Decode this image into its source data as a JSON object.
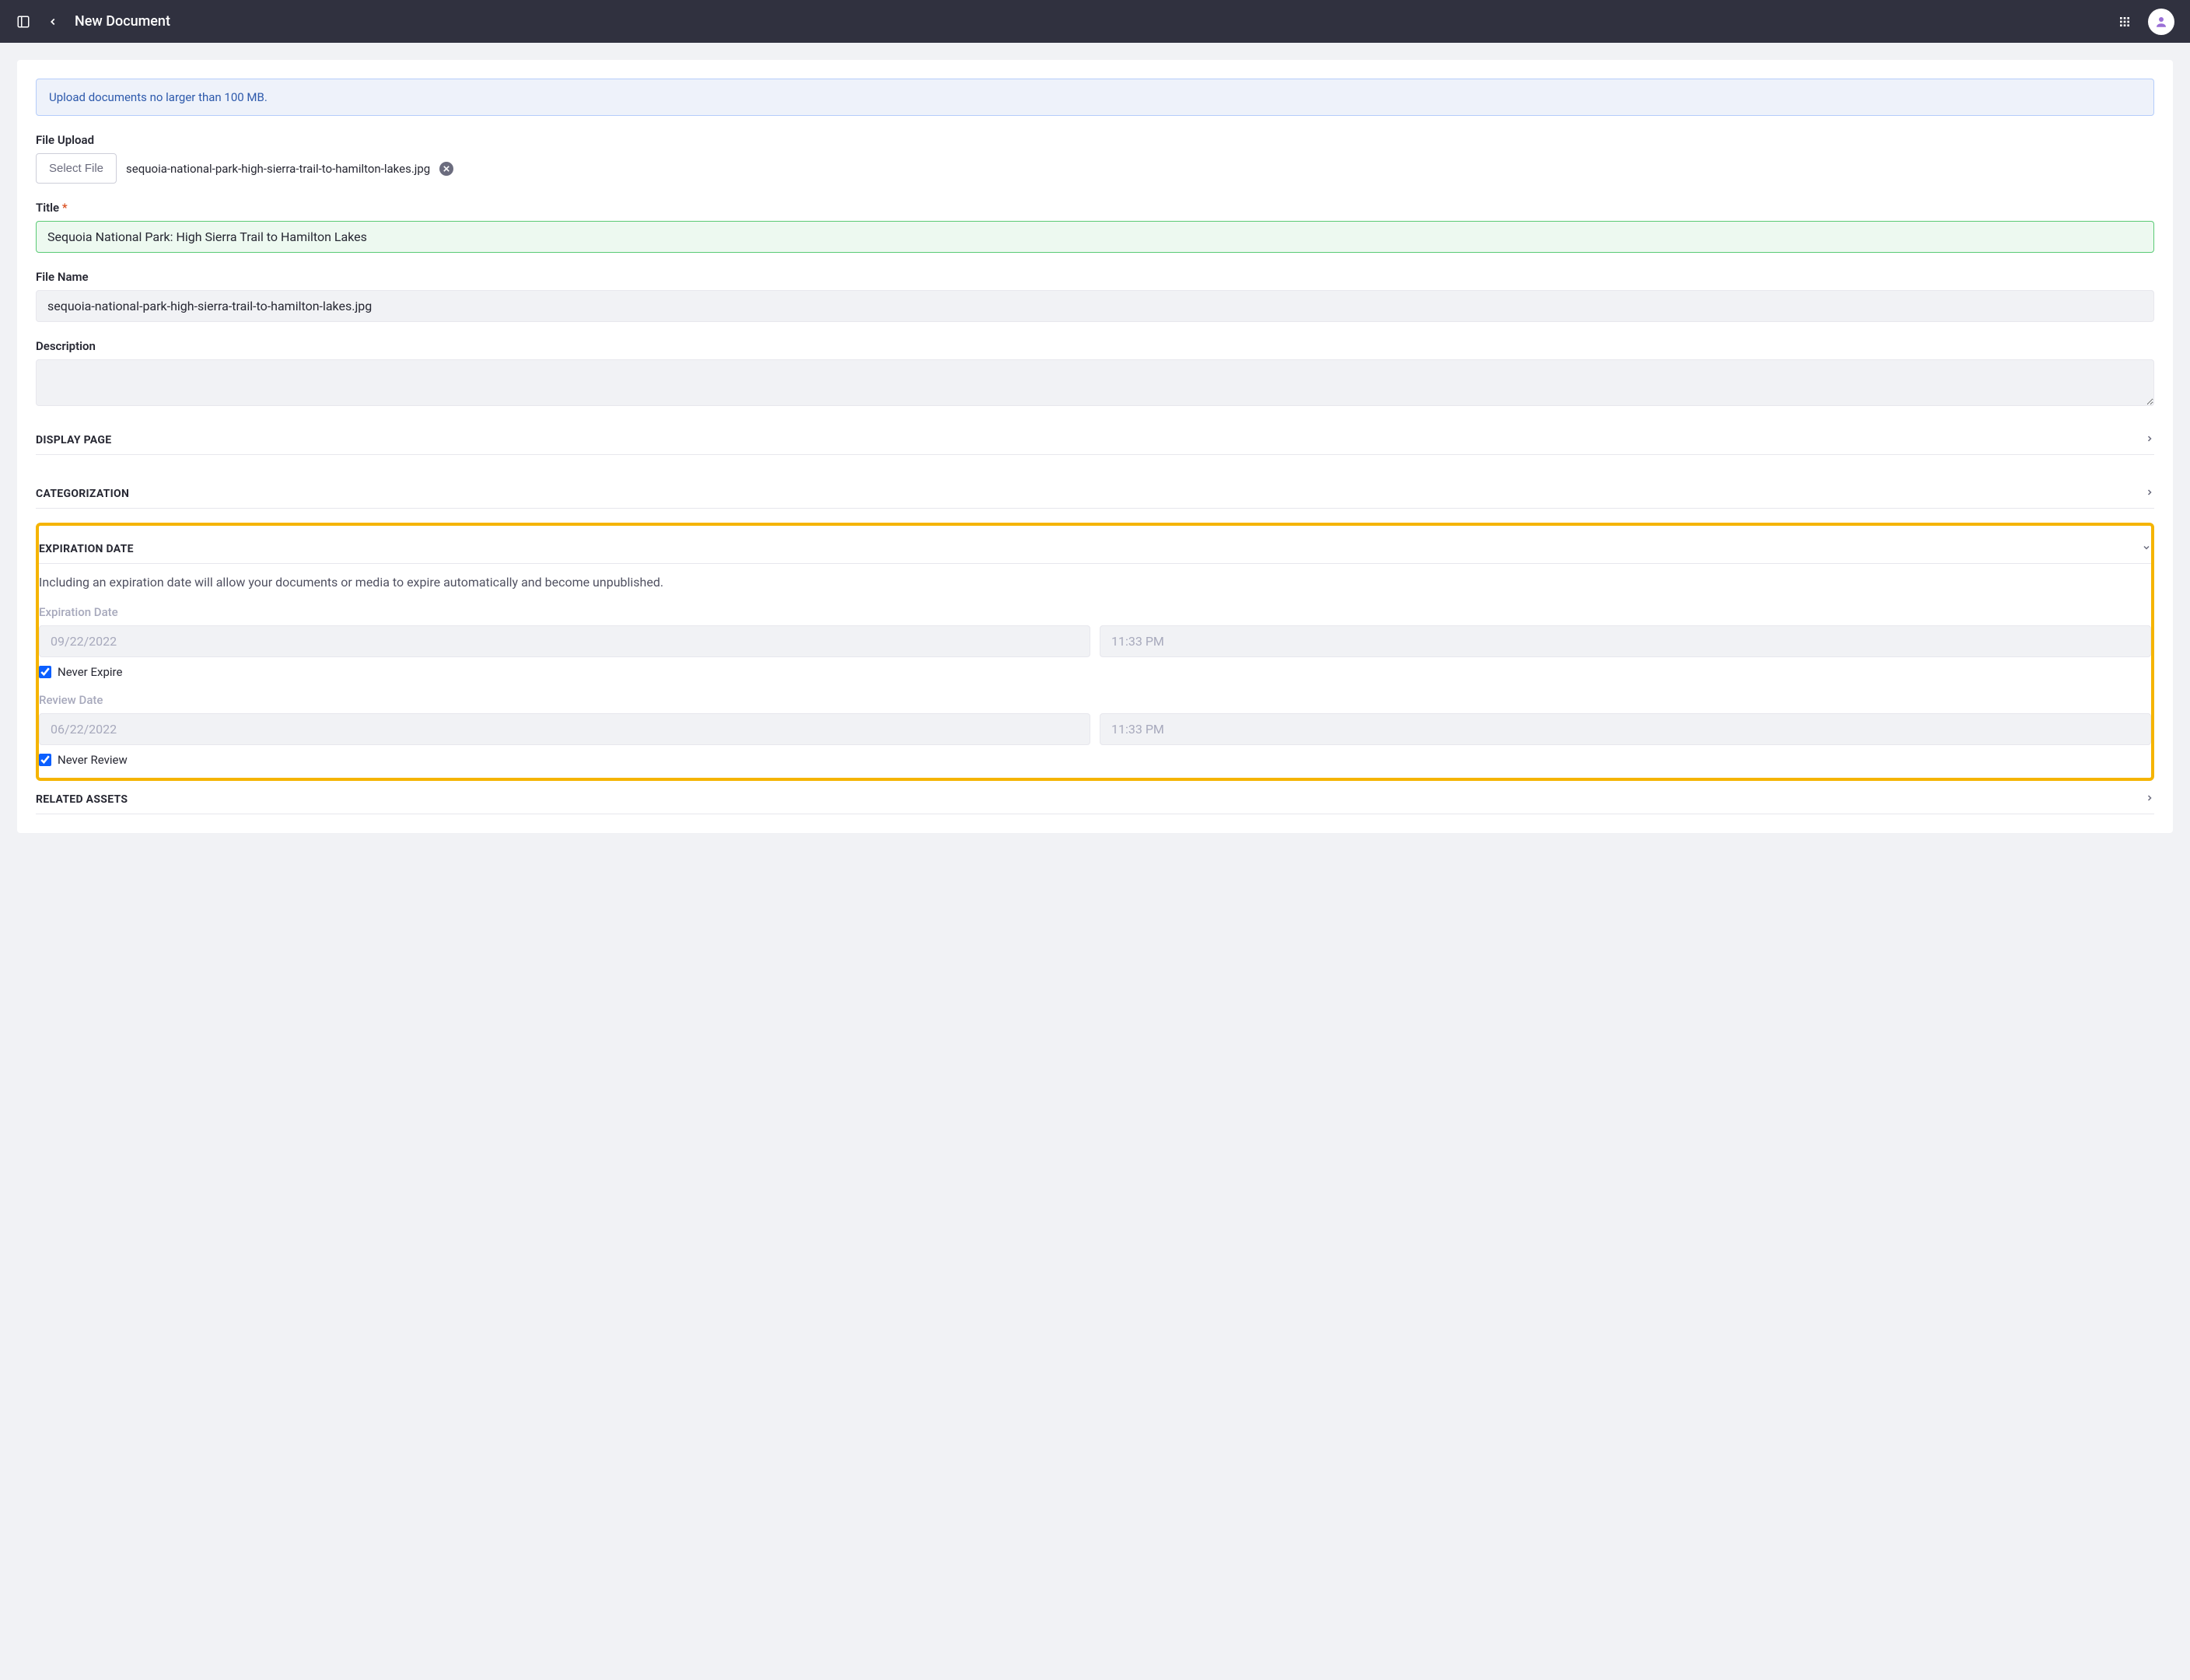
{
  "header": {
    "title": "New Document"
  },
  "banner": {
    "text": "Upload documents no larger than 100 MB."
  },
  "fileUpload": {
    "label": "File Upload",
    "buttonLabel": "Select File",
    "filename": "sequoia-national-park-high-sierra-trail-to-hamilton-lakes.jpg"
  },
  "title": {
    "label": "Title",
    "value": "Sequoia National Park: High Sierra Trail to Hamilton Lakes"
  },
  "fileName": {
    "label": "File Name",
    "value": "sequoia-national-park-high-sierra-trail-to-hamilton-lakes.jpg"
  },
  "description": {
    "label": "Description",
    "value": ""
  },
  "sections": {
    "displayPage": "DISPLAY PAGE",
    "categorization": "CATEGORIZATION",
    "expirationDate": "EXPIRATION DATE",
    "relatedAssets": "RELATED ASSETS"
  },
  "expiration": {
    "description": "Including an expiration date will allow your documents or media to expire automatically and become unpublished.",
    "expLabel": "Expiration Date",
    "expDate": "09/22/2022",
    "expTime": "11:33 PM",
    "neverExpireLabel": "Never Expire",
    "neverExpireChecked": true,
    "reviewLabel": "Review Date",
    "reviewDate": "06/22/2022",
    "reviewTime": "11:33 PM",
    "neverReviewLabel": "Never Review",
    "neverReviewChecked": true
  }
}
